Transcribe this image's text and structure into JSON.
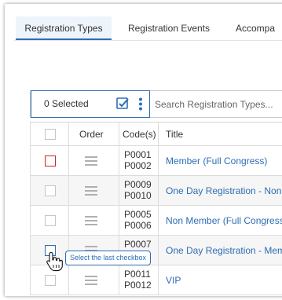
{
  "tabs": [
    {
      "label": "Registration Types",
      "active": true
    },
    {
      "label": "Registration Events",
      "active": false
    },
    {
      "label": "Accompa",
      "active": false
    }
  ],
  "toolbar": {
    "selected_label": "0 Selected",
    "search_placeholder": "Search Registration Types..."
  },
  "table": {
    "headers": {
      "order": "Order",
      "codes": "Code(s)",
      "title": "Title"
    },
    "rows": [
      {
        "code1": "P0001",
        "code2": "P0002",
        "title": "Member (Full Congress)"
      },
      {
        "code1": "P0009",
        "code2": "P0010",
        "title": "One Day Registration - Non"
      },
      {
        "code1": "P0005",
        "code2": "P0006",
        "title": "Non Member (Full Congress)"
      },
      {
        "code1": "P0007",
        "code2": "",
        "title": "One Day Registration - Mem"
      },
      {
        "code1": "P0011",
        "code2": "P0012",
        "title": "VIP"
      }
    ]
  },
  "tooltip": {
    "text": "Select the last checkbox"
  },
  "colors": {
    "accent": "#2d6db5",
    "error": "#c4242b"
  }
}
